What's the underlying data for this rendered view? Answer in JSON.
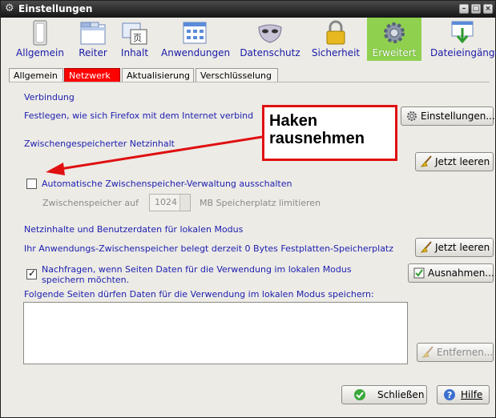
{
  "window": {
    "title": "Einstellungen"
  },
  "toolbar": {
    "items": [
      {
        "label": "Allgemein"
      },
      {
        "label": "Reiter"
      },
      {
        "label": "Inhalt"
      },
      {
        "label": "Anwendungen"
      },
      {
        "label": "Datenschutz"
      },
      {
        "label": "Sicherheit"
      },
      {
        "label": "Erweitert"
      },
      {
        "label": "Dateieingänge"
      }
    ],
    "selected": "Erweitert",
    "selected_color": "#8fd14f"
  },
  "subtabs": {
    "items": [
      {
        "label": "Allgemein"
      },
      {
        "label": "Netzwerk"
      },
      {
        "label": "Aktualisierung"
      },
      {
        "label": "Verschlüsselung"
      }
    ],
    "active": "Netzwerk",
    "active_color": "#ff0000"
  },
  "connection": {
    "heading": "Verbindung",
    "desc": "Festlegen, wie sich Firefox mit dem Internet verbind",
    "settings_button": "Einstellungen..."
  },
  "cache": {
    "heading": "Zwischengespeicherter Netzinhalt",
    "clear_button": "Jetzt leeren",
    "auto_checkbox_label": "Automatische Zwischenspeicher-Verwaltung ausschalten",
    "auto_checked": false,
    "limit_label": "Zwischenspeicher auf",
    "limit_value": "1024",
    "limit_suffix": "MB Speicherplatz limitieren"
  },
  "offline": {
    "heading": "Netzinhalte und Benutzerdaten für lokalen Modus",
    "usage_text": "Ihr Anwendungs-Zwischenspeicher belegt derzeit 0 Bytes Festplatten-Speicherplatz",
    "clear_button": "Jetzt leeren",
    "ask_label_line1": "Nachfragen, wenn Seiten Daten für die Verwendung im lokalen Modus",
    "ask_label_line2": "speichern möchten.",
    "ask_checked": true,
    "exceptions_button": "Ausnahmen...",
    "list_label": "Folgende Seiten dürfen Daten für die Verwendung im lokalen Modus speichern:",
    "remove_button": "Entfernen..."
  },
  "footer": {
    "close_button": "Schließen",
    "help_button": "Hilfe"
  },
  "annotation": {
    "text_line1": "Haken",
    "text_line2": "rausnehmen",
    "color": "#e01010"
  }
}
